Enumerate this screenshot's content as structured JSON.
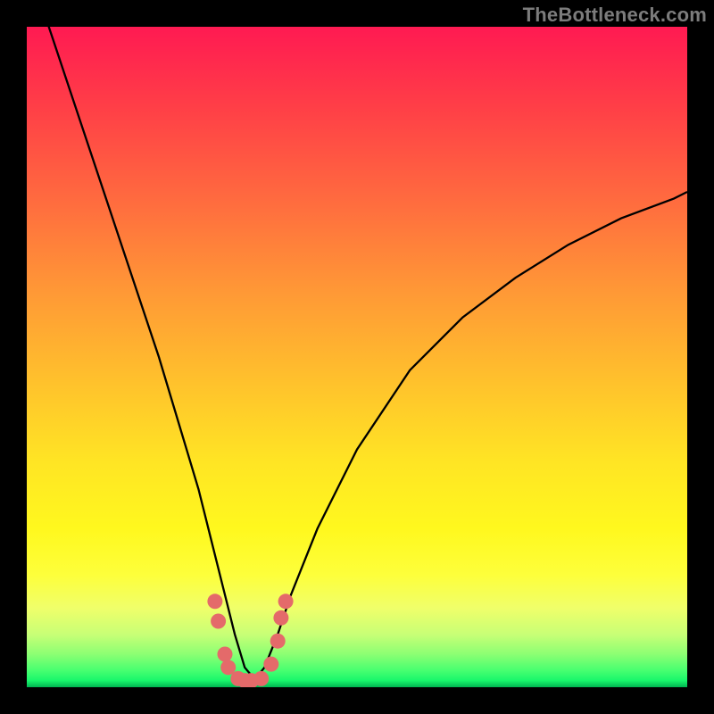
{
  "watermark": "TheBottleneck.com",
  "chart_data": {
    "type": "line",
    "title": "",
    "xlabel": "",
    "ylabel": "",
    "xlim": [
      0,
      100
    ],
    "ylim": [
      0,
      100
    ],
    "series": [
      {
        "name": "bottleneck-curve",
        "x": [
          0,
          4,
          8,
          12,
          16,
          20,
          23,
          26,
          28,
          30,
          31.5,
          33,
          34.5,
          36,
          38,
          40,
          44,
          50,
          58,
          66,
          74,
          82,
          90,
          98,
          100
        ],
        "values": [
          110,
          98,
          86,
          74,
          62,
          50,
          40,
          30,
          22,
          14,
          8,
          3,
          1.2,
          3,
          8,
          14,
          24,
          36,
          48,
          56,
          62,
          67,
          71,
          74,
          75
        ]
      }
    ],
    "highlight_markers": {
      "name": "scatter-valley",
      "color": "#e46a6a",
      "points": [
        {
          "x": 28.5,
          "y": 13
        },
        {
          "x": 29.0,
          "y": 10
        },
        {
          "x": 30.0,
          "y": 5.0
        },
        {
          "x": 30.5,
          "y": 3.0
        },
        {
          "x": 32.0,
          "y": 1.3
        },
        {
          "x": 33.0,
          "y": 1.0
        },
        {
          "x": 34.0,
          "y": 1.0
        },
        {
          "x": 35.5,
          "y": 1.3
        },
        {
          "x": 37.0,
          "y": 3.5
        },
        {
          "x": 38.0,
          "y": 7.0
        },
        {
          "x": 38.5,
          "y": 10.5
        },
        {
          "x": 39.2,
          "y": 13.0
        }
      ]
    },
    "colors": {
      "curve": "#000000",
      "marker": "#e46a6a",
      "background_frame": "#000000",
      "gradient_top": "#ff1a52",
      "gradient_bottom": "#00b552"
    }
  }
}
